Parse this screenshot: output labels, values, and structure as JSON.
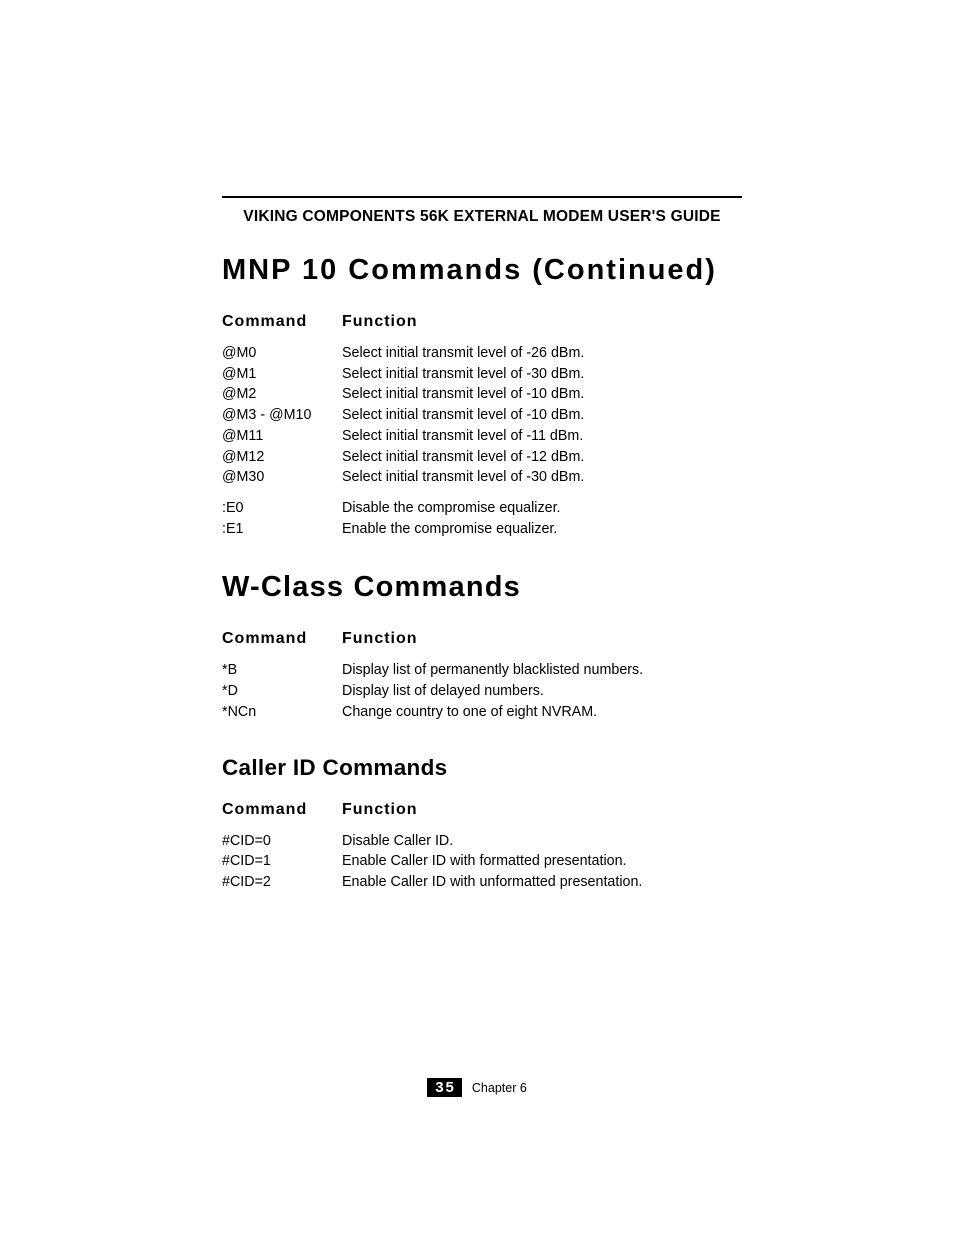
{
  "header": "VIKING COMPONENTS 56K EXTERNAL MODEM USER'S GUIDE",
  "sections": [
    {
      "title": "MNP 10 Commands (Continued)",
      "title_class": "h1",
      "col1": "Command",
      "col2": "Function",
      "groups": [
        [
          {
            "cmd": "@M0",
            "fn": "Select initial transmit level of -26 dBm."
          },
          {
            "cmd": "@M1",
            "fn": "Select initial transmit level of -30 dBm."
          },
          {
            "cmd": "@M2",
            "fn": "Select initial transmit level of -10 dBm."
          },
          {
            "cmd": "@M3 - @M10",
            "fn": "Select initial transmit level of -10 dBm."
          },
          {
            "cmd": "@M11",
            "fn": "Select initial transmit level of -11 dBm."
          },
          {
            "cmd": "@M12",
            "fn": "Select initial transmit level of -12 dBm."
          },
          {
            "cmd": "@M30",
            "fn": "Select initial transmit level of -30 dBm."
          }
        ],
        [
          {
            "cmd": ":E0",
            "fn": "Disable the compromise equalizer."
          },
          {
            "cmd": ":E1",
            "fn": "Enable the compromise equalizer."
          }
        ]
      ]
    },
    {
      "title": "W-Class Commands",
      "title_class": "h1 tight",
      "col1": "Command",
      "col2": "Function",
      "groups": [
        [
          {
            "cmd": "*B",
            "fn": "Display list of permanently blacklisted numbers."
          },
          {
            "cmd": "*D",
            "fn": "Display list of delayed numbers."
          },
          {
            "cmd": "*NCn",
            "fn": "Change country to one of eight NVRAM."
          }
        ]
      ]
    },
    {
      "title": "Caller ID Commands",
      "title_class": "h2",
      "col1": "Command",
      "col2": "Function",
      "groups": [
        [
          {
            "cmd": "#CID=0",
            "fn": "Disable Caller ID."
          },
          {
            "cmd": "#CID=1",
            "fn": "Enable Caller ID with formatted presentation."
          },
          {
            "cmd": "#CID=2",
            "fn": "Enable Caller ID with unformatted presentation."
          }
        ]
      ]
    }
  ],
  "footer": {
    "page": "35",
    "chapter": "Chapter 6"
  }
}
